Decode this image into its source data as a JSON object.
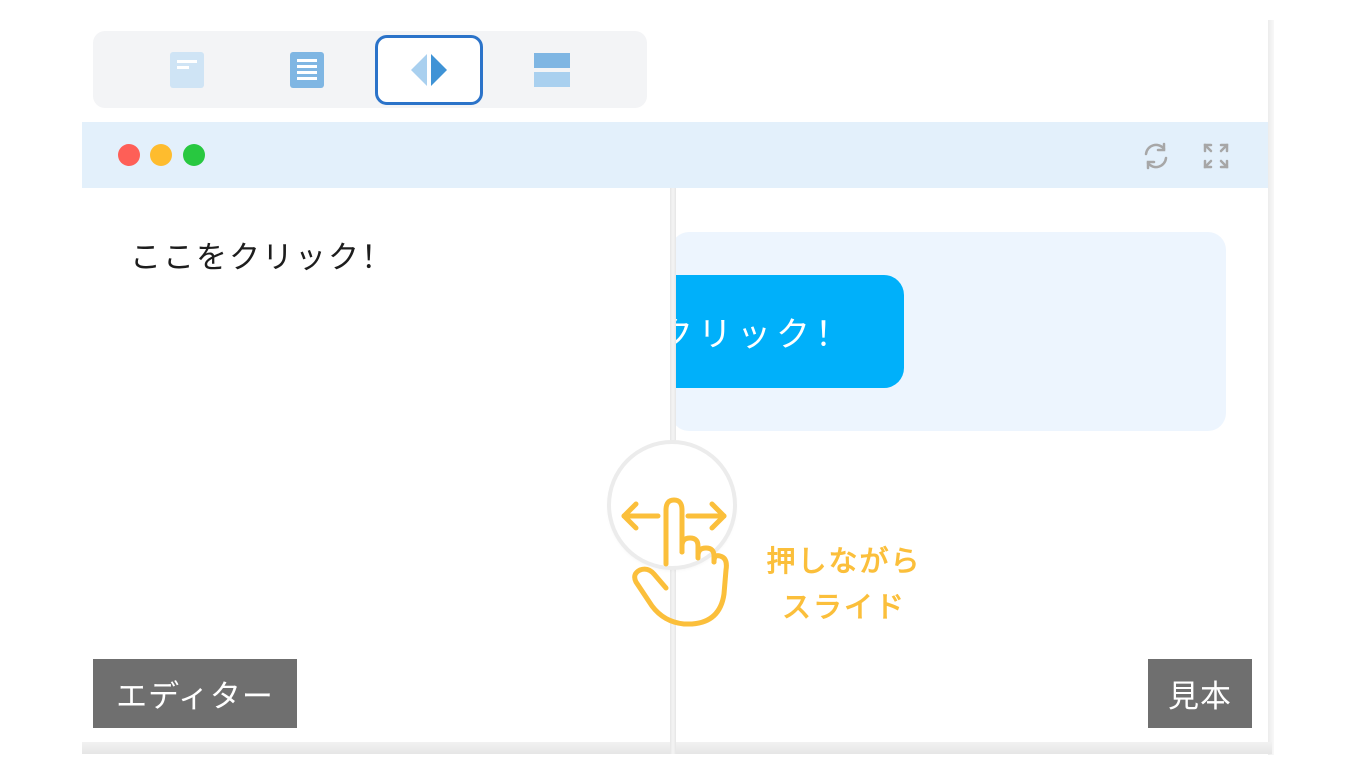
{
  "toolbar": {
    "modes": [
      {
        "icon": "document-icon",
        "active": false
      },
      {
        "icon": "list-document-icon",
        "active": false
      },
      {
        "icon": "split-view-icon",
        "active": true
      },
      {
        "icon": "stacked-view-icon",
        "active": false
      }
    ]
  },
  "window": {
    "traffic_lights": [
      "#fe5f57",
      "#febc2e",
      "#28c840"
    ],
    "icons": [
      "refresh-icon",
      "fullscreen-icon"
    ]
  },
  "editor": {
    "text": "ここをクリック！",
    "label": "エディター"
  },
  "preview": {
    "button_text": "クリック！",
    "label": "見本"
  },
  "slider": {
    "hint_line1": "押しながら",
    "hint_line2": "スライド"
  },
  "colors": {
    "accent": "#2b73c9",
    "button": "#00b0fa",
    "hint": "#fbbf3b",
    "label_bg": "#6f6f6f"
  }
}
